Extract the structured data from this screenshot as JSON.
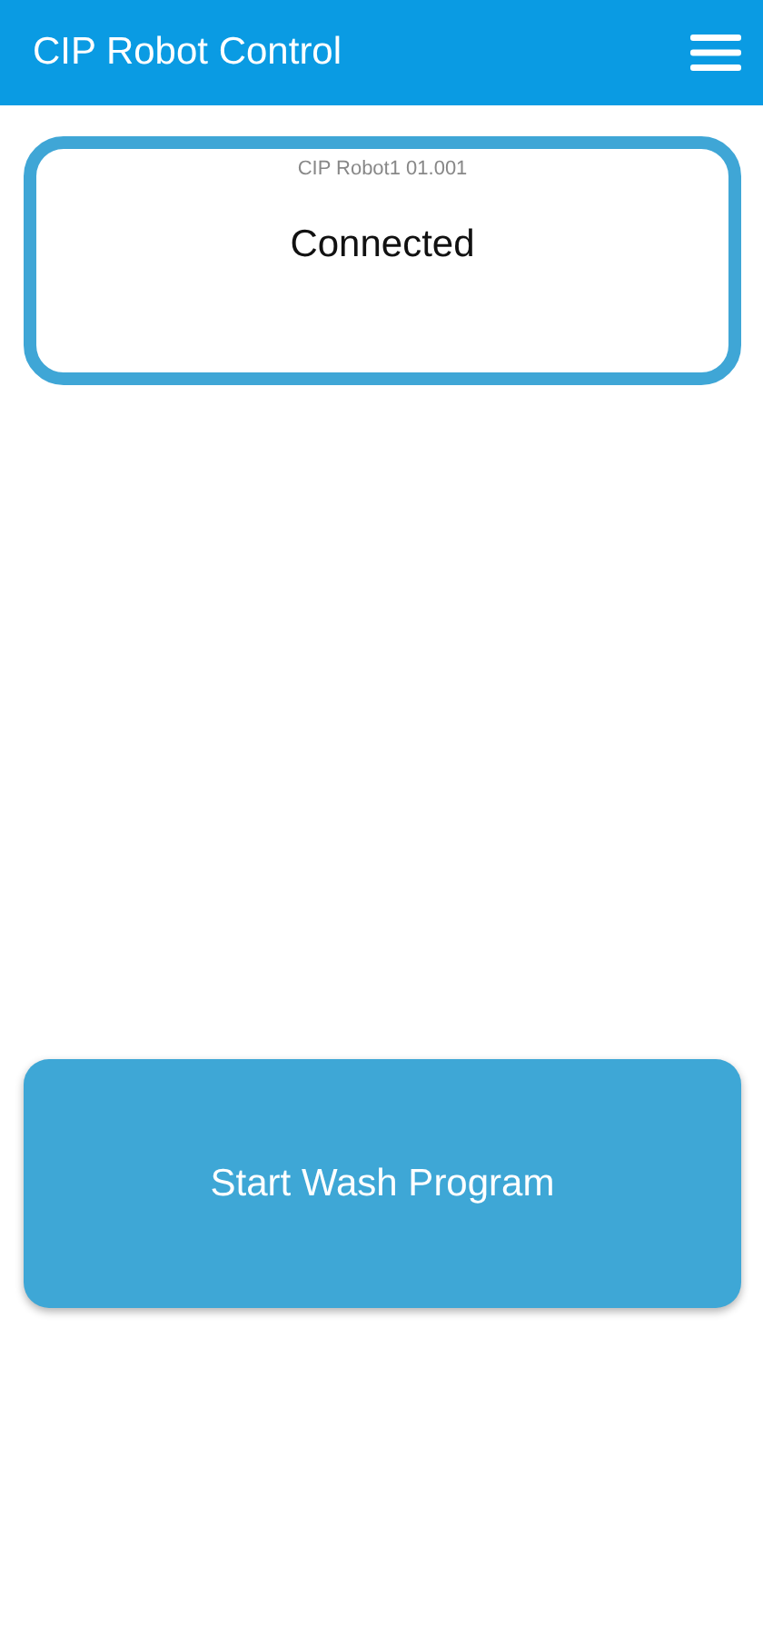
{
  "app_bar": {
    "title": "CIP Robot Control"
  },
  "status_card": {
    "device": "CIP Robot1 01.001",
    "status": "Connected"
  },
  "action_button": {
    "label": "Start Wash Program"
  }
}
